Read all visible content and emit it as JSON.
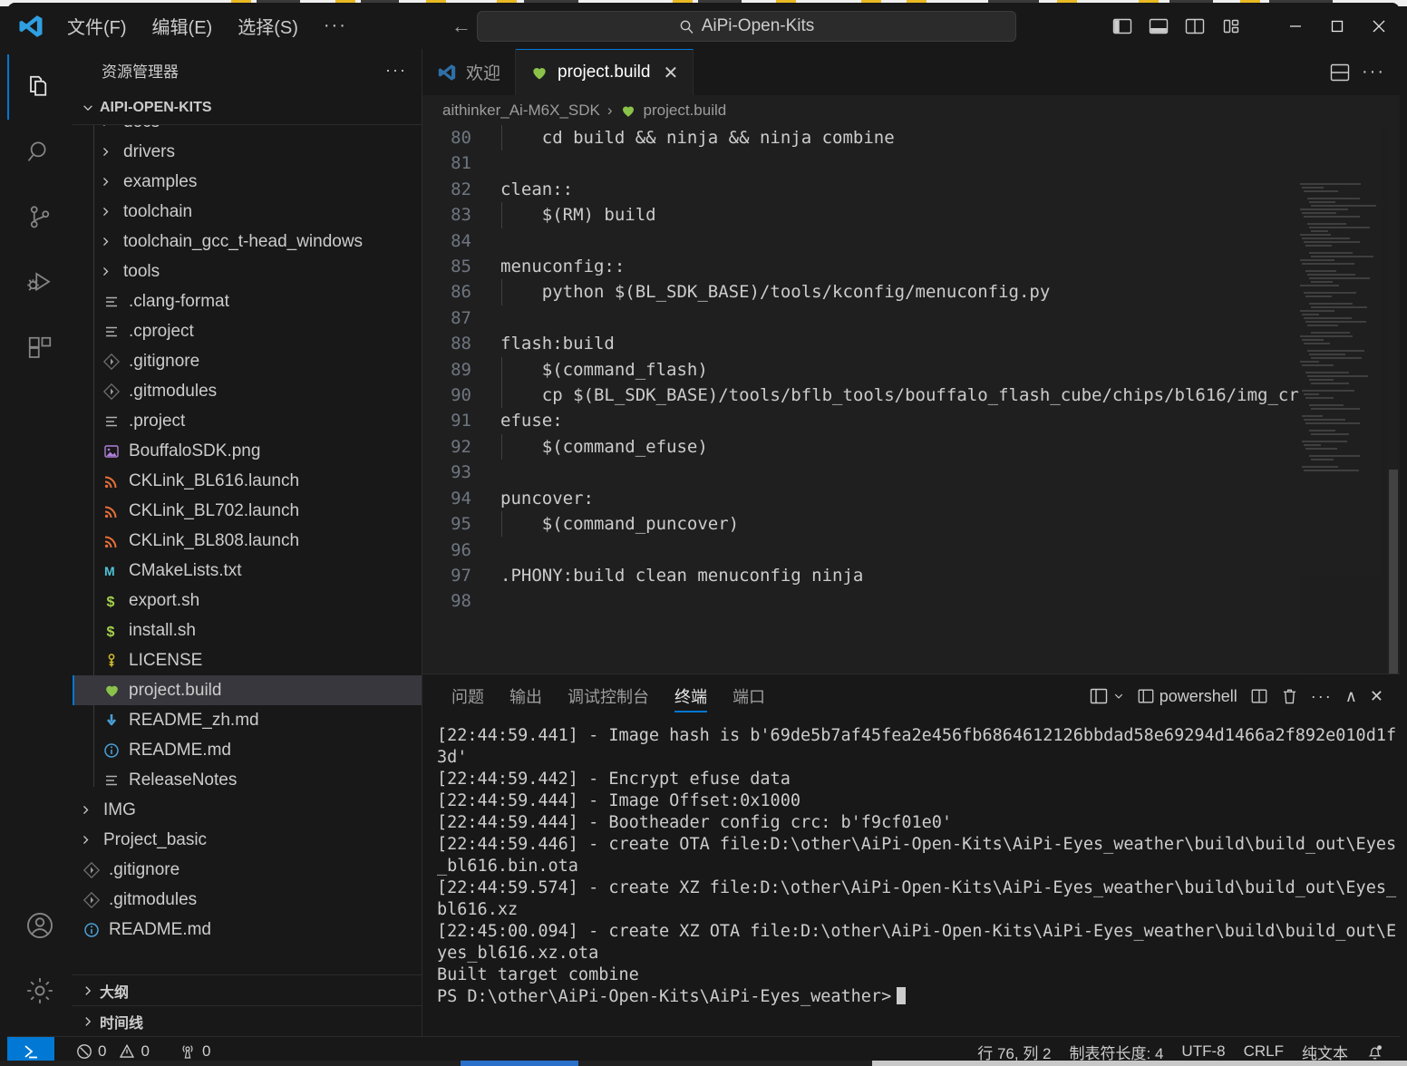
{
  "titlebar": {
    "menus": [
      "文件(F)",
      "编辑(E)",
      "选择(S)"
    ],
    "overflow_label": "···",
    "back_label": "←",
    "forward_label": "→",
    "command_center_text": "AiPi-Open-Kits",
    "layout_buttons": [
      "toggle-primary-sidebar",
      "toggle-panel",
      "toggle-secondary-sidebar",
      "customize-layout"
    ],
    "window_controls": {
      "minimize": "—",
      "maximize": "☐",
      "close": "✕"
    }
  },
  "activitybar": {
    "items": [
      {
        "name": "explorer",
        "active": true
      },
      {
        "name": "search",
        "active": false
      },
      {
        "name": "source-control",
        "active": false
      },
      {
        "name": "run-and-debug",
        "active": false
      },
      {
        "name": "extensions",
        "active": false
      }
    ],
    "bottom": [
      {
        "name": "accounts"
      },
      {
        "name": "settings"
      }
    ]
  },
  "sidebar": {
    "title": "资源管理器",
    "more_label": "···",
    "root_label": "AIPI-OPEN-KITS",
    "tree": [
      {
        "label": "docs",
        "type": "folder",
        "depth": 1,
        "clipped": true
      },
      {
        "label": "drivers",
        "type": "folder",
        "depth": 1
      },
      {
        "label": "examples",
        "type": "folder",
        "depth": 1
      },
      {
        "label": "toolchain",
        "type": "folder",
        "depth": 1
      },
      {
        "label": "toolchain_gcc_t-head_windows",
        "type": "folder",
        "depth": 1
      },
      {
        "label": "tools",
        "type": "folder",
        "depth": 1
      },
      {
        "label": ".clang-format",
        "type": "settings",
        "depth": 1
      },
      {
        "label": ".cproject",
        "type": "settings",
        "depth": 1
      },
      {
        "label": ".gitignore",
        "type": "git",
        "depth": 1
      },
      {
        "label": ".gitmodules",
        "type": "git",
        "depth": 1
      },
      {
        "label": ".project",
        "type": "settings",
        "depth": 1
      },
      {
        "label": "BouffaloSDK.png",
        "type": "image",
        "depth": 1
      },
      {
        "label": "CKLink_BL616.launch",
        "type": "launch",
        "depth": 1
      },
      {
        "label": "CKLink_BL702.launch",
        "type": "launch",
        "depth": 1
      },
      {
        "label": "CKLink_BL808.launch",
        "type": "launch",
        "depth": 1
      },
      {
        "label": "CMakeLists.txt",
        "type": "cmake",
        "depth": 1
      },
      {
        "label": "export.sh",
        "type": "shell",
        "depth": 1
      },
      {
        "label": "install.sh",
        "type": "shell",
        "depth": 1
      },
      {
        "label": "LICENSE",
        "type": "license",
        "depth": 1
      },
      {
        "label": "project.build",
        "type": "build",
        "depth": 1,
        "selected": true
      },
      {
        "label": "README_zh.md",
        "type": "md-down",
        "depth": 1
      },
      {
        "label": "README.md",
        "type": "md-info",
        "depth": 1
      },
      {
        "label": "ReleaseNotes",
        "type": "settings",
        "depth": 1
      },
      {
        "label": "IMG",
        "type": "folder",
        "depth": 0
      },
      {
        "label": "Project_basic",
        "type": "folder",
        "depth": 0
      },
      {
        "label": ".gitignore",
        "type": "git",
        "depth": 0
      },
      {
        "label": ".gitmodules",
        "type": "git",
        "depth": 0
      },
      {
        "label": "README.md",
        "type": "md-info",
        "depth": 0
      }
    ],
    "sections": [
      "大纲",
      "时间线"
    ]
  },
  "editor": {
    "tabs": [
      {
        "label": "欢迎",
        "icon": "vscode-logo",
        "active": false,
        "closable": false
      },
      {
        "label": "project.build",
        "icon": "build-heart",
        "active": true,
        "closable": true,
        "close_label": "✕"
      }
    ],
    "tab_actions": [
      "split-editor",
      "more-actions"
    ],
    "breadcrumb": [
      "aithinker_Ai-M6X_SDK",
      "project.build"
    ],
    "breadcrumb_separator": "›",
    "first_line_number": 80,
    "lines": [
      "    cd build && ninja && ninja combine",
      "",
      "clean::",
      "    $(RM) build",
      "",
      "menuconfig::",
      "    python $(BL_SDK_BASE)/tools/kconfig/menuconfig.py",
      "",
      "flash:build",
      "    $(command_flash)",
      "    cp $(BL_SDK_BASE)/tools/bflb_tools/bouffalo_flash_cube/chips/bl616/img_cr",
      "efuse:",
      "    $(command_efuse)",
      "",
      "puncover:",
      "    $(command_puncover)",
      "",
      ".PHONY:build clean menuconfig ninja",
      ""
    ]
  },
  "panel": {
    "tabs": [
      {
        "label": "问题",
        "active": false
      },
      {
        "label": "输出",
        "active": false
      },
      {
        "label": "调试控制台",
        "active": false
      },
      {
        "label": "终端",
        "active": true
      },
      {
        "label": "端口",
        "active": false
      }
    ],
    "actions": {
      "launch_profile_label": "",
      "shell_label": "powershell",
      "split_label": "",
      "kill_label": "",
      "more_label": "···",
      "maximize_label": "∧",
      "close_label": "✕"
    },
    "terminal_lines": [
      "[22:44:59.441] - Image hash is b'69de5b7af45fea2e456fb6864612126bbdad58e69294d1466a2f892e010d1f3d'",
      "[22:44:59.442] - Encrypt efuse data",
      "[22:44:59.444] - Image Offset:0x1000",
      "[22:44:59.444] - Bootheader config crc: b'f9cf01e0'",
      "[22:44:59.446] - create OTA file:D:\\other\\AiPi-Open-Kits\\AiPi-Eyes_weather\\build\\build_out\\Eyes_bl616.bin.ota",
      "[22:44:59.574] - create XZ file:D:\\other\\AiPi-Open-Kits\\AiPi-Eyes_weather\\build\\build_out\\Eyes_bl616.xz",
      "[22:45:00.094] - create XZ OTA file:D:\\other\\AiPi-Open-Kits\\AiPi-Eyes_weather\\build\\build_out\\Eyes_bl616.xz.ota",
      "Built target combine"
    ],
    "prompt": "PS D:\\other\\AiPi-Open-Kits\\AiPi-Eyes_weather>"
  },
  "statusbar": {
    "remote_label": "",
    "errors": "0",
    "warnings": "0",
    "ports": "0",
    "cursor_position": "行 76, 列 2",
    "tab_size": "制表符长度: 4",
    "encoding": "UTF-8",
    "eol": "CRLF",
    "language": "纯文本",
    "bell_label": ""
  },
  "colors": {
    "accent": "#0078d4",
    "background": "#181818",
    "editor_background": "#1f1f1f",
    "selection": "#37373d",
    "text": "#cccccc",
    "folder_chevron": "#cccccc",
    "build_icon_green": "#8bc34a",
    "launch_icon_orange": "#e8703a",
    "license_icon_yellow": "#d4c02a",
    "md_icon_blue": "#4a9fd5",
    "cmake_icon": "#4fc3d7"
  }
}
